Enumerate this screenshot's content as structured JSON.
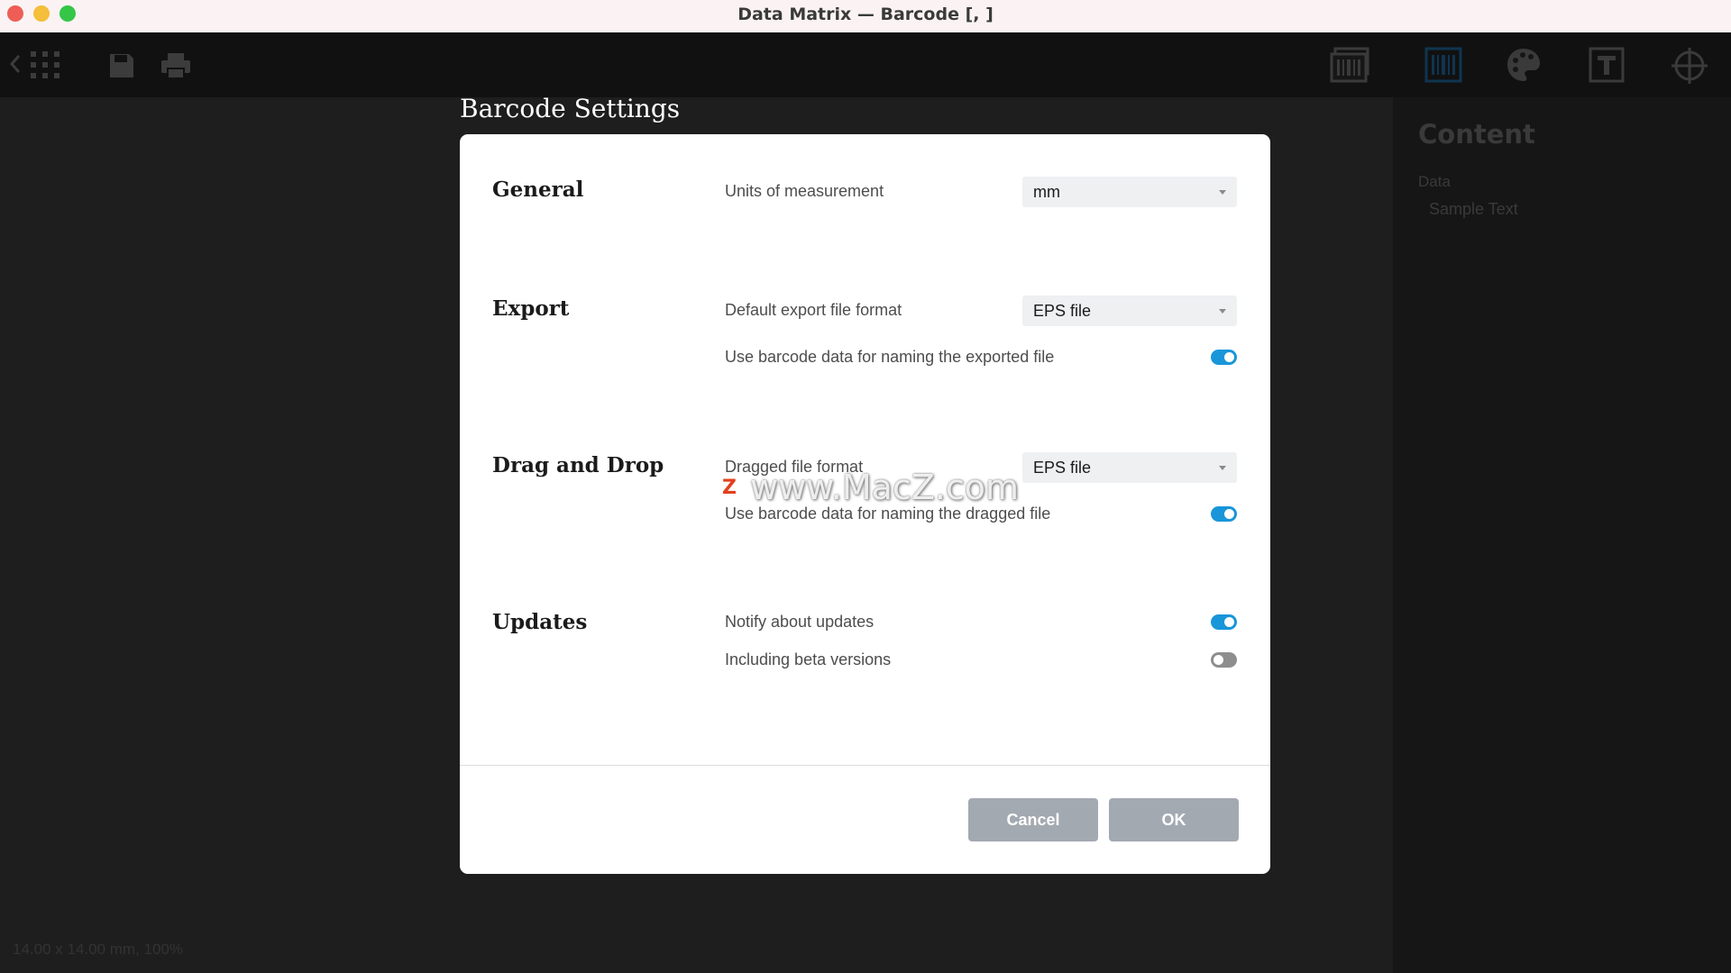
{
  "window": {
    "title": "Data Matrix — Barcode [, ]"
  },
  "toolbar": {
    "left_icons": [
      "chevron-left-icon",
      "grid-icon",
      "save-icon",
      "print-icon"
    ],
    "right_icons": [
      "barcode-stack-icon",
      "barcode-icon",
      "palette-icon",
      "text-icon",
      "crosshair-icon"
    ]
  },
  "right_panel": {
    "title": "Content",
    "data_label": "Data",
    "data_value": "Sample Text"
  },
  "status_bar": {
    "text": "14.00 x 14.00 mm, 100%"
  },
  "dialog": {
    "heading": "Barcode Settings",
    "sections": {
      "general": {
        "title": "General",
        "units_label": "Units of measurement",
        "units_value": "mm"
      },
      "export": {
        "title": "Export",
        "format_label": "Default export file format",
        "format_value": "EPS file",
        "naming_label": "Use barcode data for naming the exported file",
        "naming_on": true
      },
      "drag_drop": {
        "title": "Drag and Drop",
        "format_label": "Dragged file format",
        "format_value": "EPS file",
        "naming_label": "Use barcode data for naming the dragged file",
        "naming_on": true
      },
      "updates": {
        "title": "Updates",
        "notify_label": "Notify about updates",
        "notify_on": true,
        "beta_label": "Including beta versions",
        "beta_on": false
      }
    },
    "buttons": {
      "cancel": "Cancel",
      "ok": "OK"
    }
  },
  "watermark": {
    "text": "www.MacZ.com",
    "logo": "Z"
  },
  "colors": {
    "accent": "#1996d9",
    "button": "#a3a9b1",
    "backdrop": "#1e1e1e"
  }
}
